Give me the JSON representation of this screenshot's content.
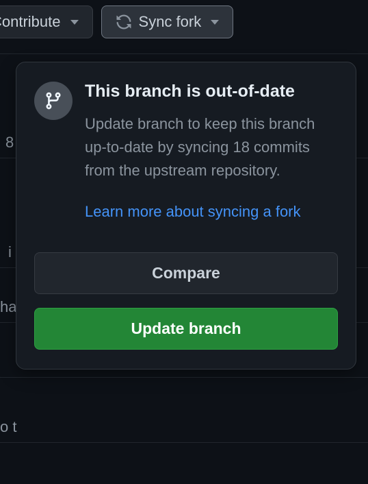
{
  "top_buttons": {
    "contribute": {
      "label": "Contribute"
    },
    "sync_fork": {
      "label": "Sync fork"
    }
  },
  "popover": {
    "heading": "This branch is out-of-date",
    "description": "Update branch to keep this branch up-to-date by syncing 18 commits from the upstream repository.",
    "link_text": "Learn more about syncing a fork",
    "compare_label": "Compare",
    "update_label": "Update branch"
  },
  "bg": {
    "l1": "8",
    "l2": "i",
    "l3": "ha",
    "l4": "o t"
  }
}
